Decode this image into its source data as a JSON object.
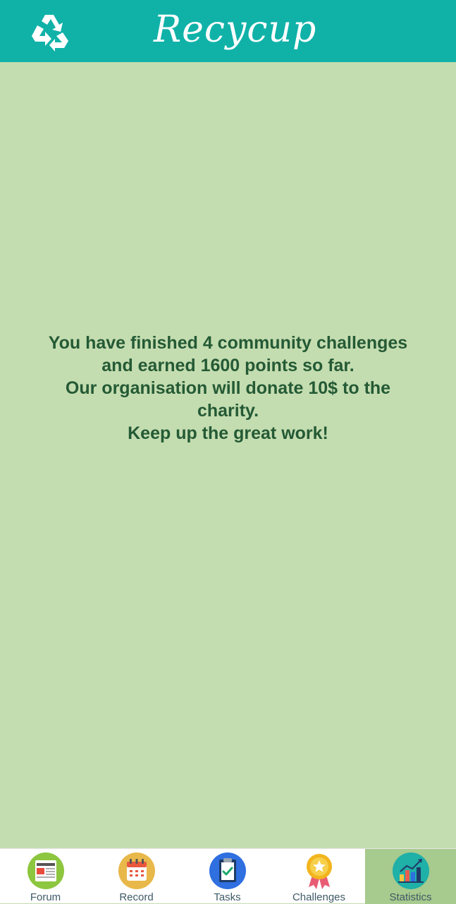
{
  "header": {
    "logo_icon": "recycle-icon",
    "title": "Recycup",
    "background_color": "#10b2a8"
  },
  "summary": {
    "line1": "You have finished 4 community challenges",
    "line2": "and earned 1600 points so far.",
    "line3": "Our organisation will donate 10$ to the",
    "line4": "charity.",
    "line5": "Keep up the great work!"
  },
  "bottom_nav": {
    "active_tab": "Statistics",
    "items": [
      {
        "label": "Forum",
        "icon": "newspaper-icon"
      },
      {
        "label": "Record",
        "icon": "calendar-icon"
      },
      {
        "label": "Tasks",
        "icon": "clipboard-check-icon"
      },
      {
        "label": "Challenges",
        "icon": "medal-icon"
      },
      {
        "label": "Statistics",
        "icon": "bar-chart-icon"
      }
    ]
  },
  "colors": {
    "brand": "#10b2a8",
    "background": "#c4ddb0",
    "text": "#245a35",
    "active_tab": "#a7ca8e"
  }
}
